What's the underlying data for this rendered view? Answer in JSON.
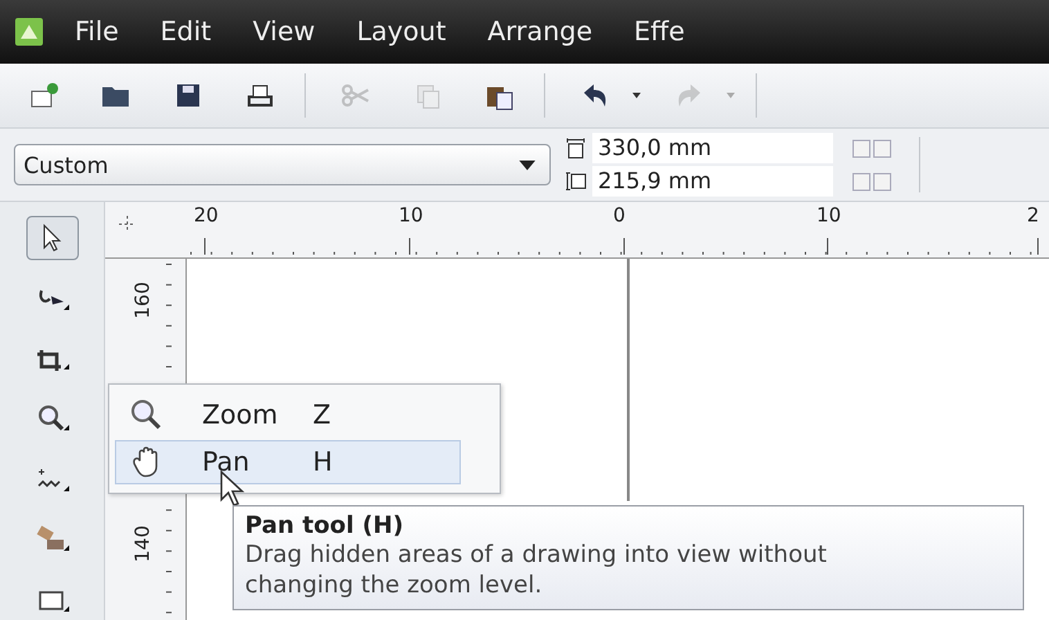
{
  "menu_bar": {
    "items": [
      "File",
      "Edit",
      "View",
      "Layout",
      "Arrange",
      "Effe"
    ]
  },
  "toolbar": {
    "buttons": [
      {
        "disabled": false
      },
      {
        "disabled": false
      },
      {
        "disabled": false
      },
      {
        "disabled": false
      },
      {
        "disabled": true
      },
      {
        "disabled": true
      },
      {
        "disabled": false
      },
      {
        "disabled": false
      },
      {
        "disabled": true
      }
    ]
  },
  "property_bar": {
    "page_size": "Custom",
    "width": "330,0 mm",
    "height": "215,9 mm"
  },
  "toolbox": {
    "tools": [
      {
        "selected": true
      },
      {
        "selected": false
      },
      {
        "selected": false
      },
      {
        "selected": false
      },
      {
        "selected": false
      },
      {
        "selected": false
      },
      {
        "selected": false
      }
    ]
  },
  "rulers": {
    "top_labels": [
      "20",
      "10",
      "0",
      "10",
      "2"
    ],
    "left_labels": [
      "160",
      "140"
    ]
  },
  "flyout": {
    "items": [
      {
        "label": "Zoom",
        "shortcut": "Z",
        "selected": false
      },
      {
        "label": "Pan",
        "shortcut": "H",
        "selected": true
      }
    ]
  },
  "tooltip": {
    "title": "Pan tool (H)",
    "text": "Drag hidden areas of a drawing into view without changing the zoom level."
  }
}
